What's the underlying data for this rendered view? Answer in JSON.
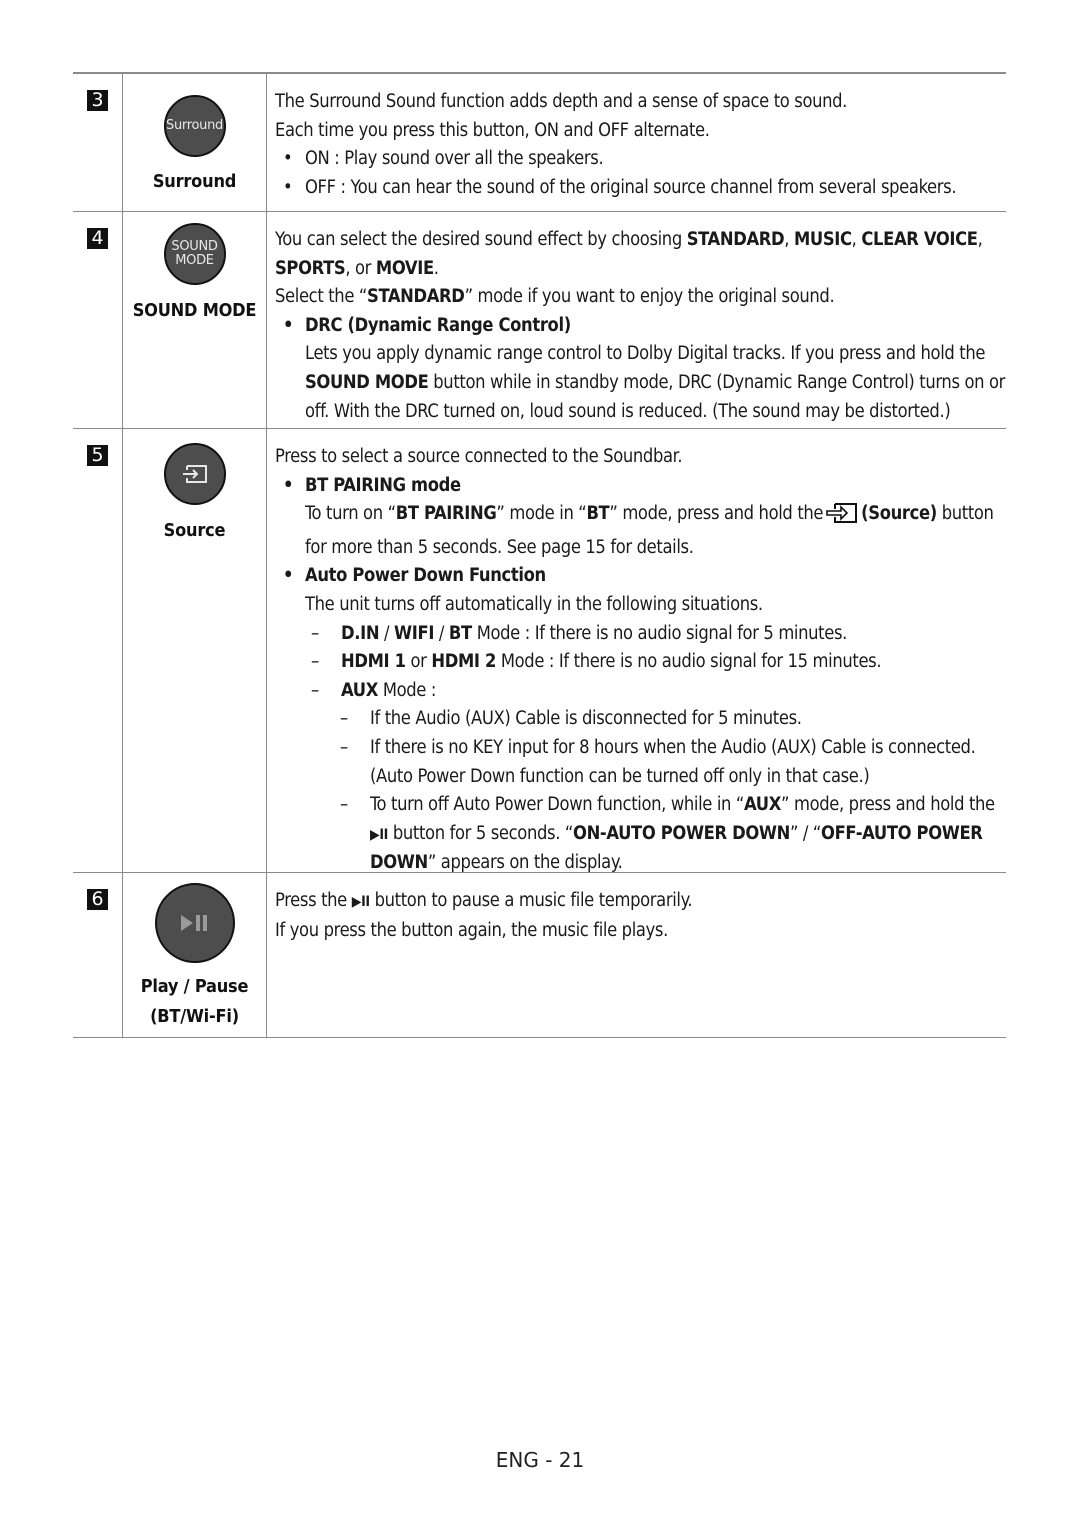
{
  "rows": [
    {
      "number": "3",
      "button_face": "Surround",
      "button_label": "Surround",
      "lines": [
        "The Surround Sound function adds depth and a sense of space to sound.",
        "Each time you press this button, ON and OFF alternate."
      ],
      "bullets": [
        "ON : Play sound over all the speakers.",
        "OFF : You can hear the sound of the original source channel from several speakers."
      ]
    },
    {
      "number": "4",
      "button_face_line1": "SOUND",
      "button_face_line2": "MODE",
      "button_label": "SOUND MODE",
      "intro_prefix": "You can select the desired sound effect by choosing ",
      "modes": [
        "STANDARD",
        "MUSIC",
        "CLEAR VOICE",
        "SPORTS",
        "MOVIE"
      ],
      "sep_comma": ", ",
      "sep_or": ", or ",
      "period": ".",
      "select_prefix": "Select the “",
      "select_bold": "STANDARD",
      "select_suffix": "” mode if you want to enjoy the original sound.",
      "drc_title": "DRC (Dynamic Range Control)",
      "drc_text1": "Lets you apply dynamic range control to Dolby Digital tracks. If you press and hold the",
      "drc_bold": "SOUND MODE",
      "drc_text2": " button while in standby mode, DRC (Dynamic Range Control) turns on or off. With the DRC turned on, loud sound is reduced. (The sound may be distorted.)"
    },
    {
      "number": "5",
      "button_icon": "source-icon",
      "button_label": "Source",
      "intro": "Press to select a source connected to the Soundbar.",
      "bt_title": "BT PAIRING mode",
      "bt_t1": "To turn on “",
      "bt_b1": "BT PAIRING",
      "bt_t2": "” mode in “",
      "bt_b2": "BT",
      "bt_t3": "” mode, press and hold the",
      "bt_b3": "(Source)",
      "bt_t4": " button for more than 5 seconds. See page 15 for details.",
      "apd_title": "Auto Power Down Function",
      "apd_intro": "The unit turns off automatically in the following situations.",
      "apd_d1_bold1": "D.IN",
      "apd_d1_sep": " / ",
      "apd_d1_bold2": "WIFI",
      "apd_d1_bold3": "BT",
      "apd_d1_text": " Mode : If there is no audio signal for 5 minutes.",
      "apd_d2_bold1": "HDMI 1",
      "apd_d2_or": " or ",
      "apd_d2_bold2": "HDMI 2",
      "apd_d2_text": " Mode : If there is no audio signal for 15 minutes.",
      "apd_d3_bold": "AUX",
      "apd_d3_text": " Mode :",
      "aux_1": "If the Audio (AUX) Cable is disconnected for 5 minutes.",
      "aux_2": "If there is no KEY input for 8 hours when the Audio (AUX) Cable is connected.",
      "aux_2b": "(Auto Power Down function can be turned off only in that case.)",
      "aux_3_t1": "To turn off Auto Power Down function, while in “",
      "aux_3_b1": "AUX",
      "aux_3_t2": "” mode, press and hold the",
      "aux_3_glyph": "▶II",
      "aux_3_t3": " button for 5 seconds. “",
      "aux_3_b2": "ON-AUTO POWER DOWN",
      "aux_3_t4": "” / “",
      "aux_3_b3": "OFF-AUTO POWER DOWN",
      "aux_3_t5": "” appears on the display."
    },
    {
      "number": "6",
      "button_icon": "play-pause-icon",
      "button_label_1": "Play / Pause",
      "button_label_2": "(BT/Wi-Fi)",
      "t1": "Press the ",
      "glyph": "▶II",
      "t2": " button to pause a music file temporarily.",
      "t3": "If you press the button again, the music file plays."
    }
  ],
  "footer": "ENG - 21"
}
